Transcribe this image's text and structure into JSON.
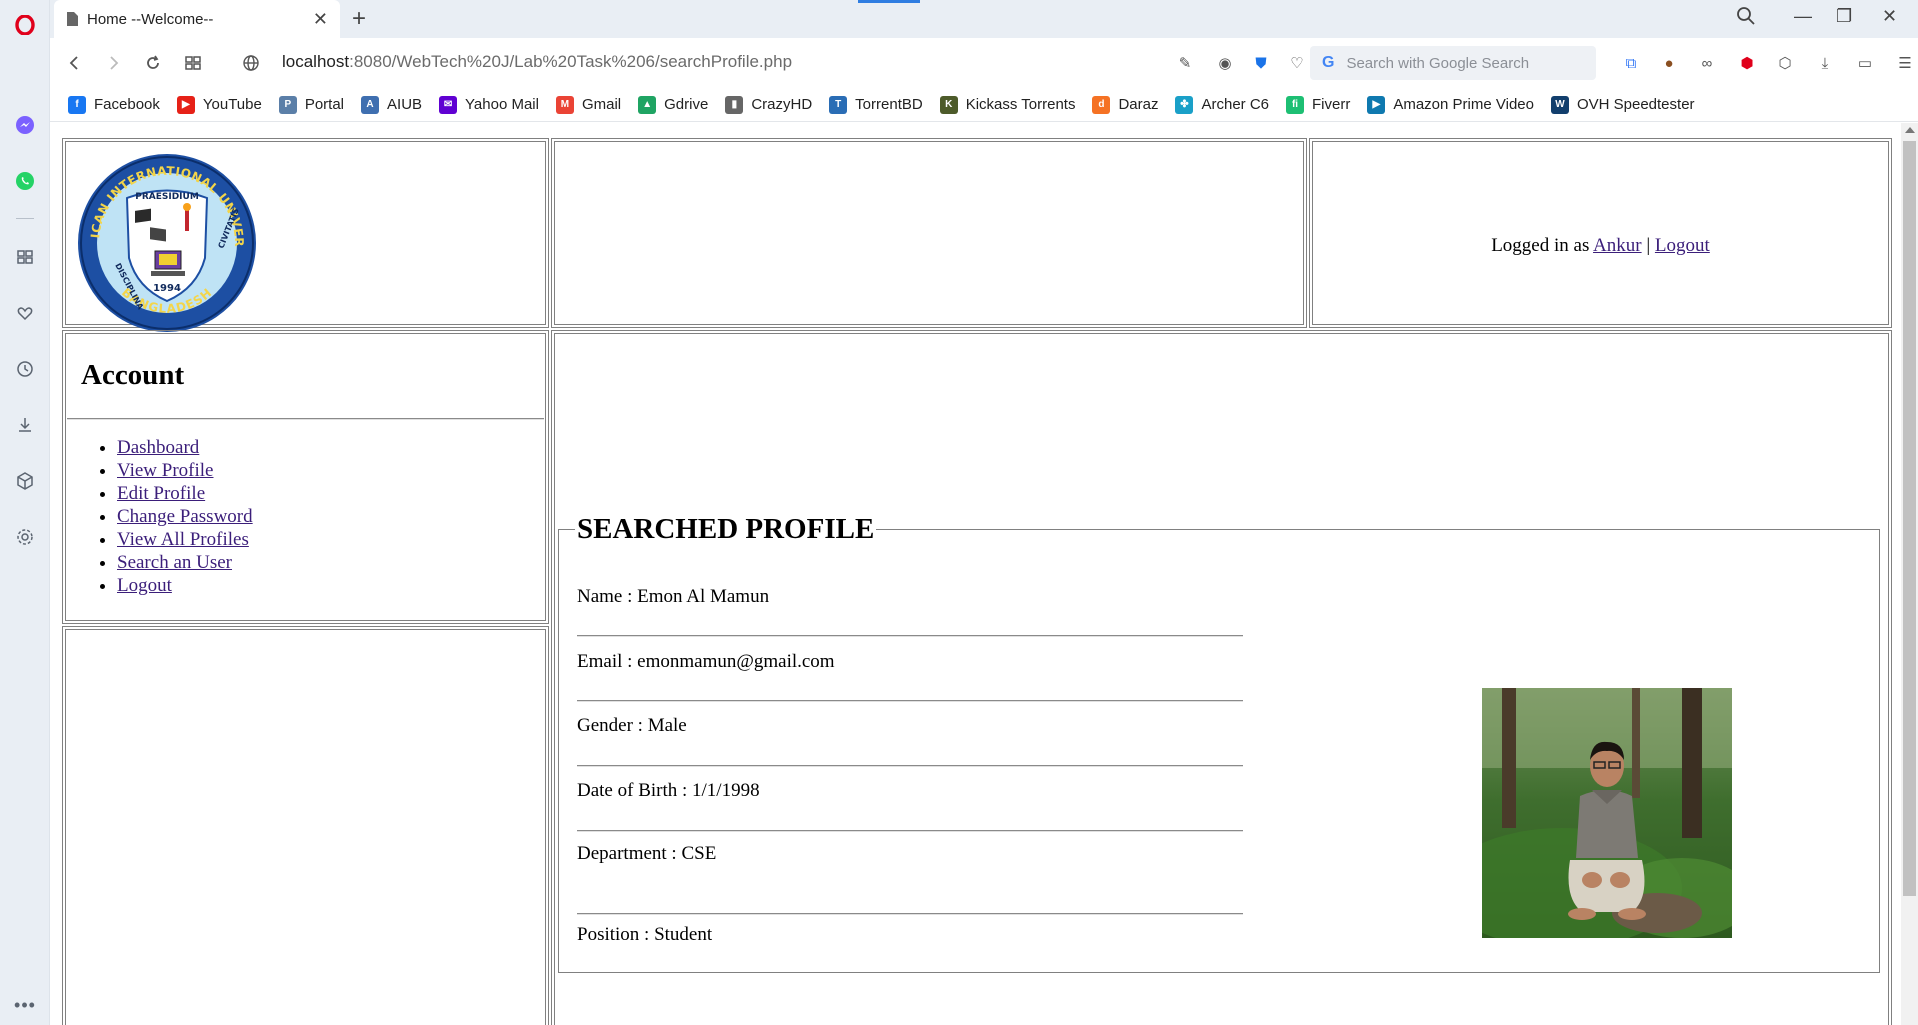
{
  "browser": {
    "tab_title": "Home --Welcome--",
    "new_tab_symbol": "+",
    "url_host": "localhost",
    "url_rest": ":8080/WebTech%20J/Lab%20Task%206/searchProfile.php",
    "search_placeholder": "Search with Google Search",
    "bookmarks": [
      {
        "label": "Facebook",
        "icon": "facebook-icon",
        "color": "#1877f2",
        "glyph": "f"
      },
      {
        "label": "YouTube",
        "icon": "youtube-icon",
        "color": "#e62117",
        "glyph": "▶"
      },
      {
        "label": "Portal",
        "icon": "portal-icon",
        "color": "#5b7fa8",
        "glyph": "P"
      },
      {
        "label": "AIUB",
        "icon": "aiub-icon",
        "color": "#3f6fb0",
        "glyph": "A"
      },
      {
        "label": "Yahoo Mail",
        "icon": "yahoo-mail-icon",
        "color": "#6001d2",
        "glyph": "✉"
      },
      {
        "label": "Gmail",
        "icon": "gmail-icon",
        "color": "#ea4335",
        "glyph": "M"
      },
      {
        "label": "Gdrive",
        "icon": "gdrive-icon",
        "color": "#1fa463",
        "glyph": "▲"
      },
      {
        "label": "CrazyHD",
        "icon": "crazyhd-icon",
        "color": "#666666",
        "glyph": "▮"
      },
      {
        "label": "TorrentBD",
        "icon": "torrentbd-icon",
        "color": "#2a6db5",
        "glyph": "T"
      },
      {
        "label": "Kickass Torrents",
        "icon": "kickass-icon",
        "color": "#4d5b2a",
        "glyph": "K"
      },
      {
        "label": "Daraz",
        "icon": "daraz-icon",
        "color": "#f57224",
        "glyph": "d"
      },
      {
        "label": "Archer C6",
        "icon": "archer-icon",
        "color": "#1aa0c8",
        "glyph": "✤"
      },
      {
        "label": "Fiverr",
        "icon": "fiverr-icon",
        "color": "#1dbf73",
        "glyph": "fi"
      },
      {
        "label": "Amazon Prime Video",
        "icon": "prime-video-icon",
        "color": "#0f79af",
        "glyph": "▶"
      },
      {
        "label": "OVH Speedtester",
        "icon": "ovh-icon",
        "color": "#123f6d",
        "glyph": "W"
      }
    ]
  },
  "page": {
    "logged_in_prefix": "Logged in as",
    "user_link": "Ankur",
    "separator": "|",
    "logout_link": "Logout",
    "account_title": "Account",
    "menu": [
      "Dashboard",
      "View Profile",
      "Edit Profile",
      "Change Password",
      "View All Profiles",
      "Search an User",
      "Logout"
    ],
    "profile_legend": "SEARCHED PROFILE",
    "fields": [
      "Name : Emon Al Mamun",
      "Email : emonmamun@gmail.com",
      "Gender : Male",
      "Date of Birth : 1/1/1998",
      "Department : CSE",
      "Position : Student"
    ],
    "logo": {
      "top_text": "AMERICAN INTERNATIONAL UNIVERSITY",
      "motto": "PRAESIDIUM",
      "left_text": "DISCIPLINA",
      "right_text": "CIVITATIS",
      "year": "1994",
      "bottom_text": "BANGLADESH"
    }
  }
}
